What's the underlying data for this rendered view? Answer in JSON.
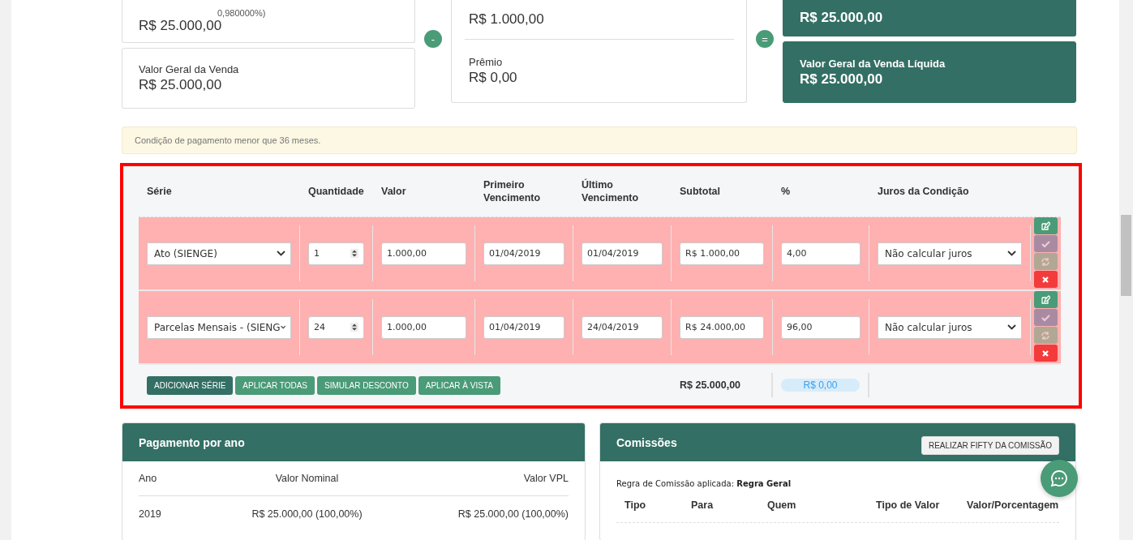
{
  "summary": {
    "left_cards": [
      {
        "note": "0,980000%)",
        "value": "R$ 25.000,00"
      },
      {
        "label": "Valor Geral da Venda",
        "value": "R$ 25.000,00"
      }
    ],
    "minus": "-",
    "middle_card": [
      {
        "value": "R$ 1.000,00"
      },
      {
        "label": "Prêmio",
        "value": "R$ 0,00"
      }
    ],
    "equals": "=",
    "right_cards": [
      {
        "value": "R$ 25.000,00"
      },
      {
        "label": "Valor Geral da Venda Líquida",
        "value": "R$ 25.000,00"
      }
    ]
  },
  "alert": "Condição de pagamento menor que 36 meses.",
  "series_table": {
    "columns": [
      "Série",
      "Quantidade",
      "Valor",
      "Primeiro Vencimento",
      "Último Vencimento",
      "Subtotal",
      "%",
      "Juros da Condição"
    ],
    "rows": [
      {
        "serie": "Ato (SIENGE)",
        "quantidade": "1",
        "valor": "1.000,00",
        "primeiro_vencimento": "01/04/2019",
        "ultimo_vencimento": "01/04/2019",
        "subtotal": "R$ 1.000,00",
        "percentual": "4,00",
        "juros": "Não calcular juros",
        "invalid": true
      },
      {
        "serie": "Parcelas Mensais - (SIENG",
        "quantidade": "24",
        "valor": "1.000,00",
        "primeiro_vencimento": "01/04/2019",
        "ultimo_vencimento": "24/04/2019",
        "subtotal": "R$ 24.000,00",
        "percentual": "96,00",
        "juros": "Não calcular juros",
        "invalid": true
      }
    ],
    "buttons": [
      {
        "label": "ADICIONAR SÉRIE",
        "kind": "primary"
      },
      {
        "label": "APLICAR TODAS",
        "kind": "secondary"
      },
      {
        "label": "SIMULAR DESCONTO",
        "kind": "secondary"
      },
      {
        "label": "APLICAR À VISTA",
        "kind": "secondary"
      }
    ],
    "total": "R$ 25.000,00",
    "difference": "R$ 0,00"
  },
  "payment_per_year": {
    "title": "Pagamento por ano",
    "columns": [
      "Ano",
      "Valor Nominal",
      "Valor VPL"
    ],
    "rows": [
      [
        "2019",
        "R$ 25.000,00 (100,00%)",
        "R$ 25.000,00 (100,00%)"
      ]
    ]
  },
  "commissions": {
    "title": "Comissões",
    "button": "REALIZAR FIFTY DA COMISSÃO",
    "rule": "Regra de Comissão aplicada: **Regra Geral**",
    "columns": [
      "Tipo",
      "Para",
      "Quem",
      "Tipo de Valor",
      "Valor/Porcentagem"
    ]
  }
}
